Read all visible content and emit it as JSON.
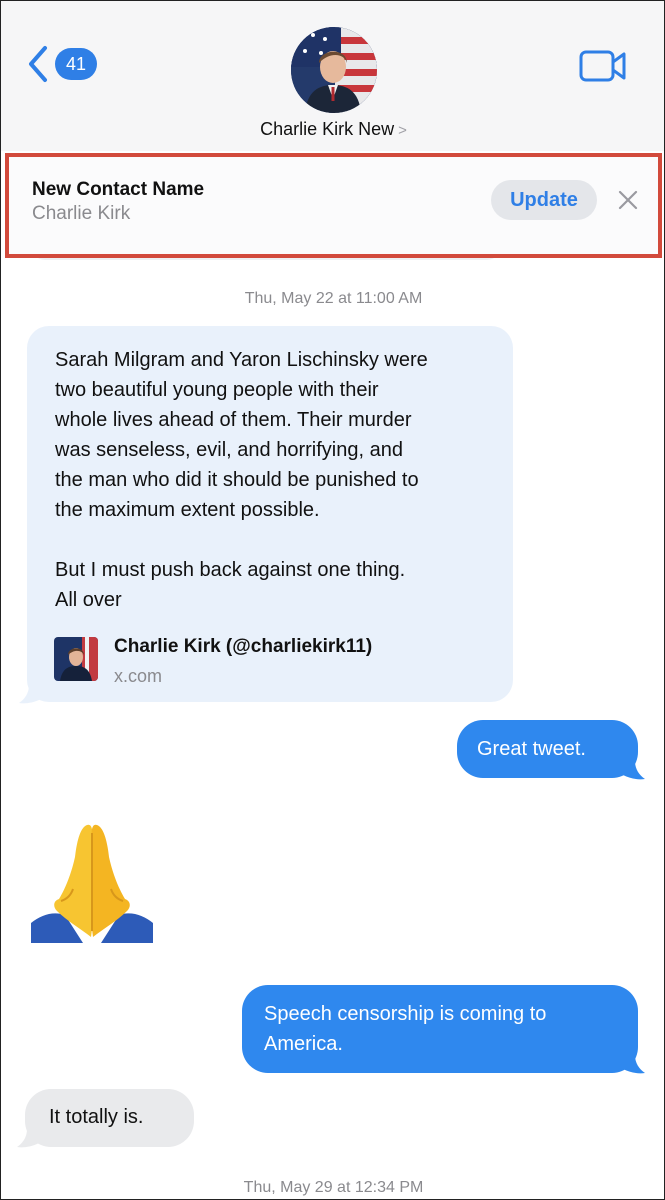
{
  "header": {
    "back_count": "41",
    "contact_name": "Charlie Kirk New",
    "contact_chevron": ">"
  },
  "banner": {
    "title": "New Contact Name",
    "subtitle": "Charlie Kirk",
    "update_label": "Update",
    "close_icon": "close-icon"
  },
  "messages": {
    "timestamp_1": "Thu, May 22 at 11:00 AM",
    "incoming_text_1": "Sarah Milgram and Yaron Lischinsky were\ntwo beautiful young people with their\nwhole lives ahead of them. Their murder\nwas senseless, evil, and horrifying, and\nthe man who did it should be punished to\nthe maximum extent possible.\n\nBut I must push back against one thing.\nAll over",
    "link_title": "Charlie Kirk (@charliekirk11)",
    "link_domain": "x.com",
    "outgoing_1": "Great tweet.",
    "emoji": "folded-hands-emoji",
    "outgoing_2": "Speech censorship is coming to\nAmerica.",
    "incoming_2": "It totally is.",
    "timestamp_2": "Thu, May 29 at 12:34 PM"
  },
  "colors": {
    "accent": "#2f7fe6",
    "outgoing_bubble": "#2f88ee",
    "incoming_bubble": "#e9f1fb",
    "incoming_plain_bubble": "#e9eaec",
    "banner_border": "#d24a3c"
  }
}
